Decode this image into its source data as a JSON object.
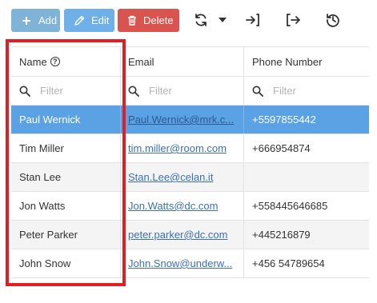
{
  "toolbar": {
    "add_label": "Add",
    "edit_label": "Edit",
    "delete_label": "Delete",
    "icons": [
      "plus-icon",
      "pencil-icon",
      "trash-icon",
      "refresh-icon",
      "caret-down-icon",
      "login-icon",
      "logout-icon",
      "history-icon"
    ]
  },
  "grid": {
    "columns": [
      {
        "label": "Name",
        "help_icon": "?"
      },
      {
        "label": "Email"
      },
      {
        "label": "Phone Number"
      }
    ],
    "filter_placeholder": "Filter",
    "rows": [
      {
        "name": "Paul Wernick",
        "email": "Paul.Wernick@mrk.c...",
        "phone": "+5597855442",
        "selected": true
      },
      {
        "name": "Tim Miller",
        "email": "tim.miller@room.com",
        "phone": "+666954874"
      },
      {
        "name": "Stan Lee",
        "email": "Stan.Lee@celan.it",
        "phone": ""
      },
      {
        "name": "Jon Watts",
        "email": "Jon.Watts@dc.com",
        "phone": "+558445646685"
      },
      {
        "name": "Peter Parker",
        "email": "peter.parker@dc.com",
        "phone": "+445216879"
      },
      {
        "name": "John Snow",
        "email": "John.Snow@underw...",
        "phone": "+456 54789654"
      }
    ]
  },
  "colors": {
    "add_button": "#7fb3d8",
    "edit_button": "#6fb0e8",
    "delete_button": "#d9534f",
    "selected_row": "#5aa2e4",
    "highlight_box": "#e01e24"
  }
}
